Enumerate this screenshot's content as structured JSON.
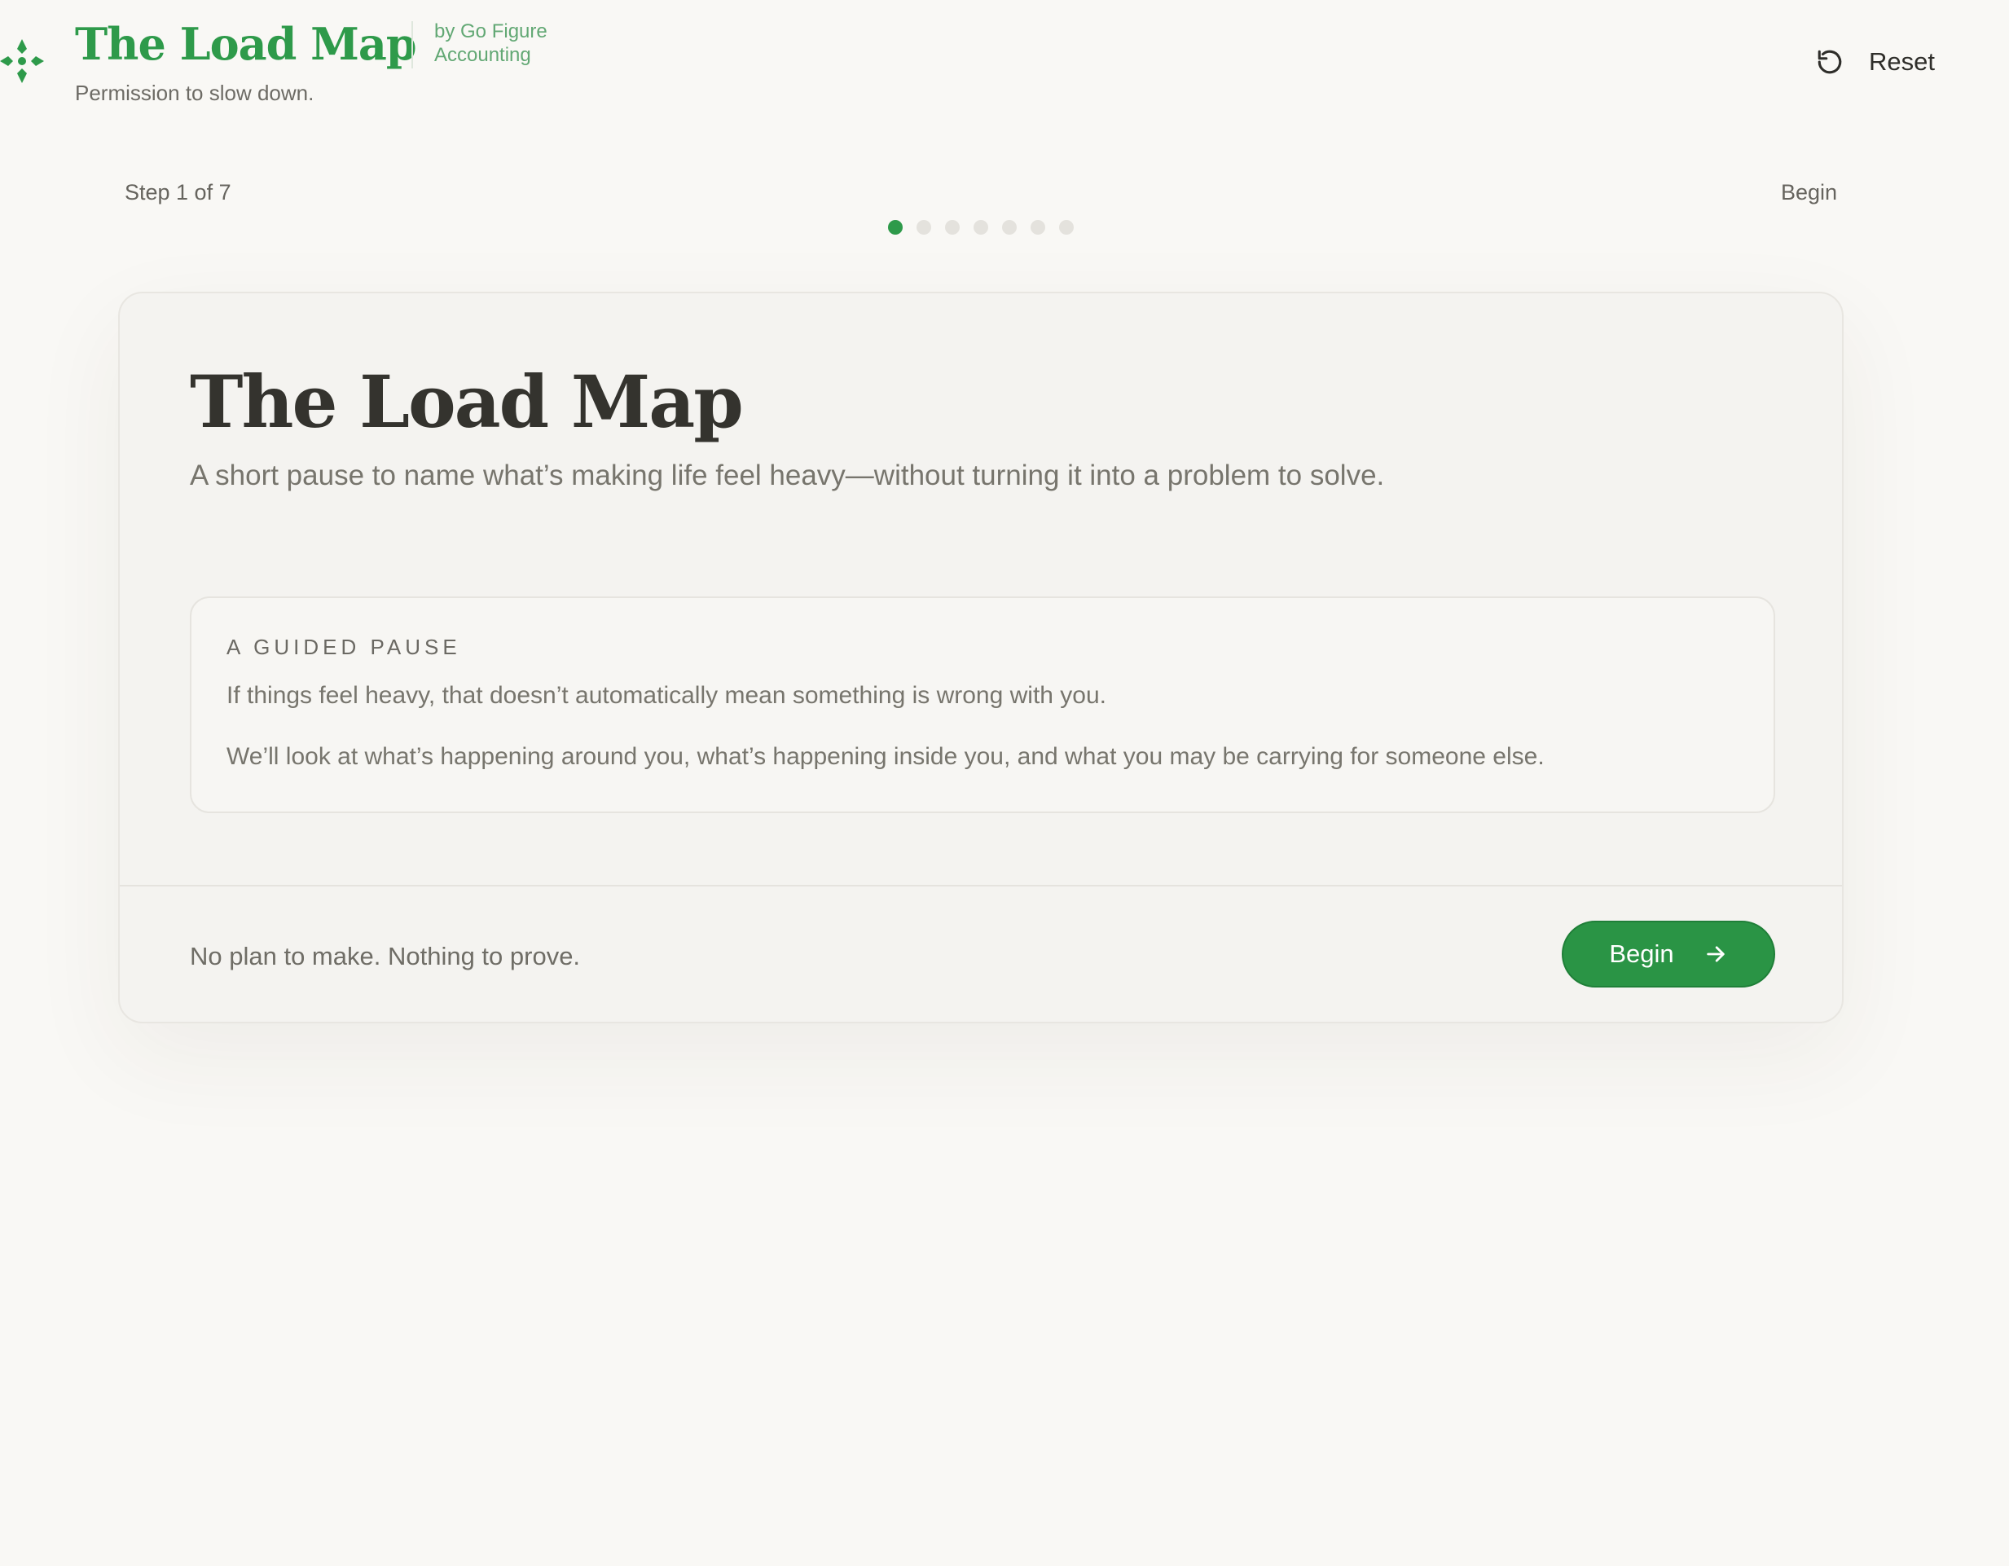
{
  "header": {
    "title": "The Load Map",
    "by_line1": "by Go Figure",
    "by_line2": "Accounting",
    "tagline": "Permission to slow down.",
    "logo_icon": "compass-diamond-icon",
    "reset_label": "Reset",
    "reset_icon": "rotate-ccw-icon"
  },
  "progress": {
    "step_label": "Step 1 of 7",
    "step_name": "Begin",
    "current_step": 1,
    "total_steps": 7
  },
  "card": {
    "title": "The Load Map",
    "intro": "A short pause to name what’s making life feel heavy—without turning it into a problem to solve.",
    "pause": {
      "eyebrow": "A GUIDED PAUSE",
      "line1": "If things feel heavy, that doesn’t automatically mean something is wrong with you.",
      "line2": "We’ll look at what’s happening around you, what’s happening inside you, and what you may be carrying for someone else."
    },
    "footer_text": "No plan to make. Nothing to prove.",
    "begin_label": "Begin",
    "begin_icon": "arrow-right-icon"
  },
  "colors": {
    "brand_green": "#2e9a4a",
    "button_green": "#2a9445",
    "background": "#f9f8f5",
    "card_background": "#f4f3f0",
    "dot_inactive": "#e4e2dd"
  }
}
